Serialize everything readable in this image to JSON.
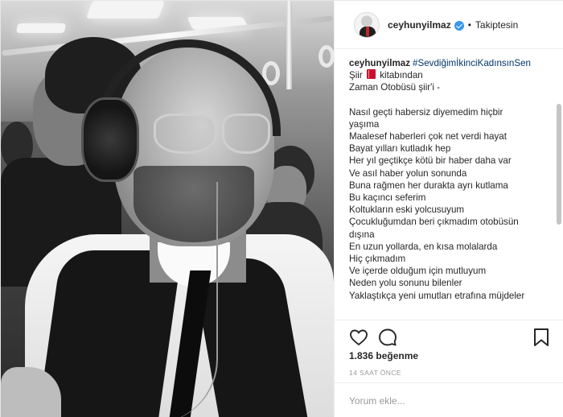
{
  "post": {
    "username": "ceyhunyilmaz",
    "follow_status": "Takiptesin",
    "separator": "•",
    "photo_alt": "Fotoğraf",
    "caption": {
      "username": "ceyhunyilmaz",
      "hashtag": "#SevdiğimİkinciKadınsınSen",
      "line_prefix": "Şiir",
      "line_suffix": "kitabından",
      "title_line": "Zaman Otobüsü şiir'i -",
      "poem": [
        "Nasıl geçti habersiz diyemedim hiçbir",
        "yaşıma",
        "Maalesef haberleri çok net verdi hayat",
        "Bayat yılları kutladık hep",
        "Her yıl geçtikçe kötü bir haber daha var",
        "Ve asıl haber yolun sonunda",
        "Buna rağmen her durakta ayrı kutlama",
        "Bu kaçıncı seferim",
        "Koltukların eski yolcusuyum",
        "Çocukluğumdan beri çıkmadım otobüsün",
        "dışına",
        "En uzun yollarda, en kısa molalarda",
        "Hiç çıkmadım",
        "Ve içerde olduğum için mutluyum",
        "Neden yolu sonunu bilenler",
        "Yaklaştıkça yeni umutları etrafına müjdeler"
      ]
    },
    "likes": "1.836 beğenme",
    "time_ago": "14 SAAT ÖNCE",
    "comment_placeholder": "Yorum ekle..."
  },
  "icons": {
    "like": "heart-icon",
    "comment": "comment-icon",
    "save": "bookmark-icon",
    "verified": "verified-badge-icon",
    "book": "red-book-emoji"
  },
  "colors": {
    "text": "#262626",
    "hashtag": "#003569",
    "muted": "#999999",
    "verified": "#3897f0",
    "border": "#efefef"
  }
}
